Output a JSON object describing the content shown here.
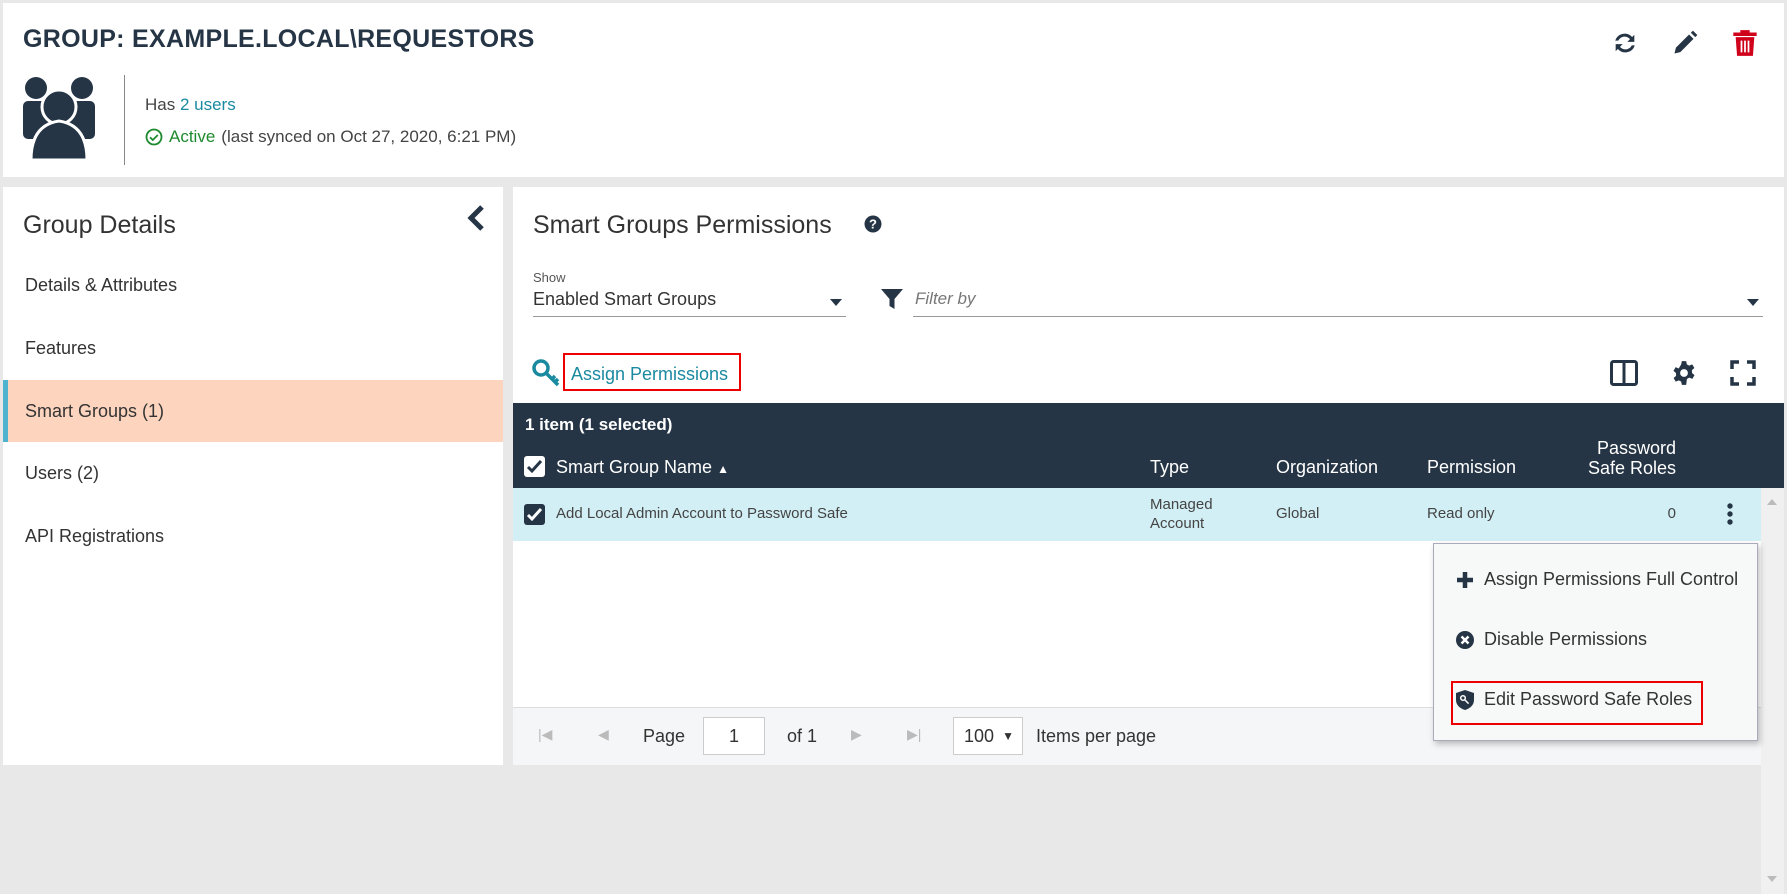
{
  "header": {
    "title": "GROUP: EXAMPLE.LOCAL\\REQUESTORS",
    "has_prefix": "Has",
    "users_link": "2 users",
    "status": "Active",
    "sync_text": "(last synced on Oct 27, 2020, 6:21 PM)",
    "icons": [
      "refresh-icon",
      "pencil-icon",
      "trash-icon"
    ]
  },
  "sidebar": {
    "title": "Group Details",
    "items": [
      {
        "label": "Details & Attributes"
      },
      {
        "label": "Features"
      },
      {
        "label": "Smart Groups (1)",
        "selected": true
      },
      {
        "label": "Users (2)"
      },
      {
        "label": "API Registrations"
      }
    ]
  },
  "main": {
    "title": "Smart Groups Permissions",
    "show_label": "Show",
    "show_value": "Enabled Smart Groups",
    "filter_placeholder": "Filter by",
    "assign_label": "Assign Permissions",
    "grid": {
      "summary": "1 item (1 selected)",
      "columns": [
        "Smart Group Name",
        "Type",
        "Organization",
        "Permission",
        "Password Safe Roles"
      ],
      "rows": [
        {
          "name": "Add Local Admin Account to Password Safe",
          "type": "Managed Account",
          "organization": "Global",
          "permission": "Read only",
          "roles": "0",
          "checked": true
        }
      ]
    },
    "context_menu": [
      {
        "label": "Assign Permissions Full Control",
        "icon": "plus-icon"
      },
      {
        "label": "Disable Permissions",
        "icon": "x-circle-icon"
      },
      {
        "label": "Edit Password Safe Roles",
        "icon": "shield-key-icon"
      }
    ],
    "pager": {
      "page_label": "Page",
      "page": "1",
      "of_label": "of 1",
      "per_page": "100",
      "per_page_label": "Items per page"
    }
  },
  "colors": {
    "dark": "#253545",
    "accent": "#1a8aa0",
    "selected": "#fdd5bf",
    "row_selected": "#d2eff5",
    "active": "#1e8a2e",
    "delete": "#d0021b"
  }
}
